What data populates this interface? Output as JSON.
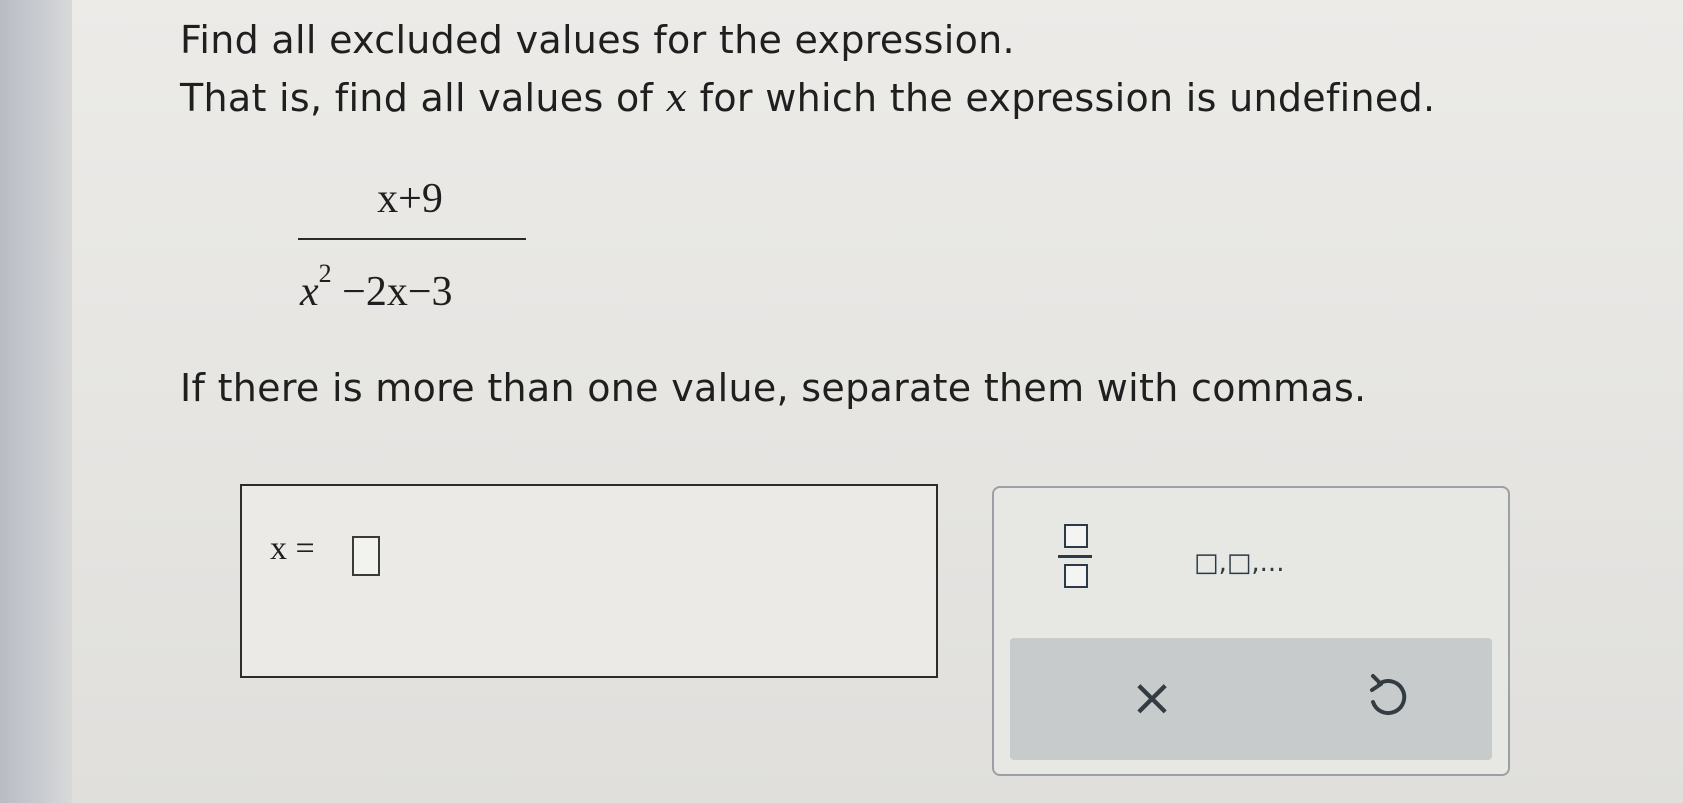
{
  "question": {
    "line1": "Find all excluded values for the expression.",
    "line2_before": "That is, find all values of ",
    "line2_var": "x",
    "line2_after": " for which the expression is undefined.",
    "instruction": "If there is more than one value, separate them with commas."
  },
  "expression": {
    "numerator": "x+9",
    "denominator": {
      "var": "x",
      "exponent": "2",
      "rest": " −2x−3"
    }
  },
  "answer": {
    "label": "x =",
    "value": ""
  },
  "keypad": {
    "fraction_key": "fraction-template",
    "list_key": "□,□,...",
    "clear_key": "×",
    "undo_key": "undo-icon"
  }
}
